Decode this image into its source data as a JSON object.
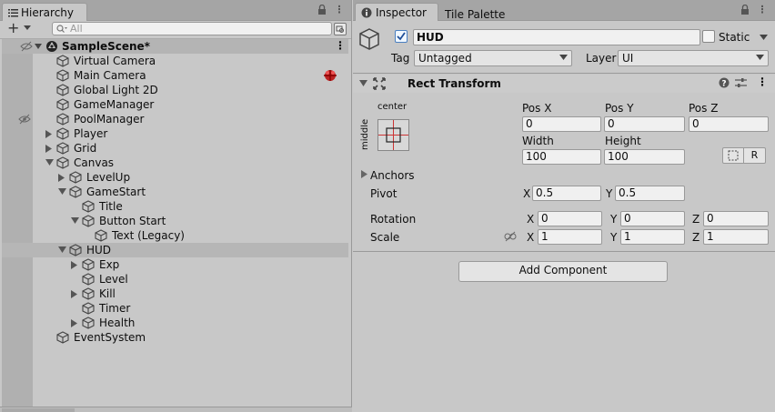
{
  "hierarchy": {
    "tab_label": "Hierarchy",
    "search_placeholder": "All",
    "add_label": "+",
    "scene_name": "SampleScene*",
    "items": [
      {
        "label": "Virtual Camera",
        "depth": 0,
        "expand": "none",
        "selected": false
      },
      {
        "label": "Main Camera",
        "depth": 0,
        "expand": "none",
        "selected": false
      },
      {
        "label": "Global Light 2D",
        "depth": 0,
        "expand": "none",
        "selected": false
      },
      {
        "label": "GameManager",
        "depth": 0,
        "expand": "none",
        "selected": false
      },
      {
        "label": "PoolManager",
        "depth": 0,
        "expand": "none",
        "selected": false
      },
      {
        "label": "Player",
        "depth": 0,
        "expand": "collapsed",
        "selected": false
      },
      {
        "label": "Grid",
        "depth": 0,
        "expand": "collapsed",
        "selected": false
      },
      {
        "label": "Canvas",
        "depth": 0,
        "expand": "expanded",
        "selected": false
      },
      {
        "label": "LevelUp",
        "depth": 1,
        "expand": "collapsed",
        "selected": false
      },
      {
        "label": "GameStart",
        "depth": 1,
        "expand": "expanded",
        "selected": false
      },
      {
        "label": "Title",
        "depth": 2,
        "expand": "none",
        "selected": false
      },
      {
        "label": "Button Start",
        "depth": 2,
        "expand": "expanded",
        "selected": false
      },
      {
        "label": "Text (Legacy)",
        "depth": 3,
        "expand": "none",
        "selected": false
      },
      {
        "label": "HUD",
        "depth": 1,
        "expand": "expanded",
        "selected": true
      },
      {
        "label": "Exp",
        "depth": 2,
        "expand": "collapsed",
        "selected": false
      },
      {
        "label": "Level",
        "depth": 2,
        "expand": "none",
        "selected": false
      },
      {
        "label": "Kill",
        "depth": 2,
        "expand": "collapsed",
        "selected": false
      },
      {
        "label": "Timer",
        "depth": 2,
        "expand": "none",
        "selected": false
      },
      {
        "label": "Health",
        "depth": 2,
        "expand": "collapsed",
        "selected": false
      },
      {
        "label": "EventSystem",
        "depth": 0,
        "expand": "none",
        "selected": false
      }
    ]
  },
  "inspector": {
    "tab_label": "Inspector",
    "tab2_label": "Tile Palette",
    "object_name": "HUD",
    "static_label": "Static",
    "tag_label": "Tag",
    "tag_value": "Untagged",
    "layer_label": "Layer",
    "layer_value": "UI",
    "component_title": "Rect Transform",
    "anchor_h": "center",
    "anchor_v": "middle",
    "pos_x_label": "Pos X",
    "pos_y_label": "Pos Y",
    "pos_z_label": "Pos Z",
    "pos_x": "0",
    "pos_y": "0",
    "pos_z": "0",
    "width_label": "Width",
    "height_label": "Height",
    "width": "100",
    "height": "100",
    "raw_label": "R",
    "anchors_label": "Anchors",
    "pivot_label": "Pivot",
    "pivot_x": "0.5",
    "pivot_y": "0.5",
    "rotation_label": "Rotation",
    "rot_x": "0",
    "rot_y": "0",
    "rot_z": "0",
    "scale_label": "Scale",
    "scale_x": "1",
    "scale_y": "1",
    "scale_z": "1",
    "x_label": "X",
    "y_label": "Y",
    "z_label": "Z",
    "add_component_label": "Add Component"
  },
  "colors": {
    "panel_bg": "#c8c8c8",
    "tab_bar": "#a5a5a5",
    "selected_row": "#b6b6b6",
    "field_bg": "#f0f0f0"
  }
}
